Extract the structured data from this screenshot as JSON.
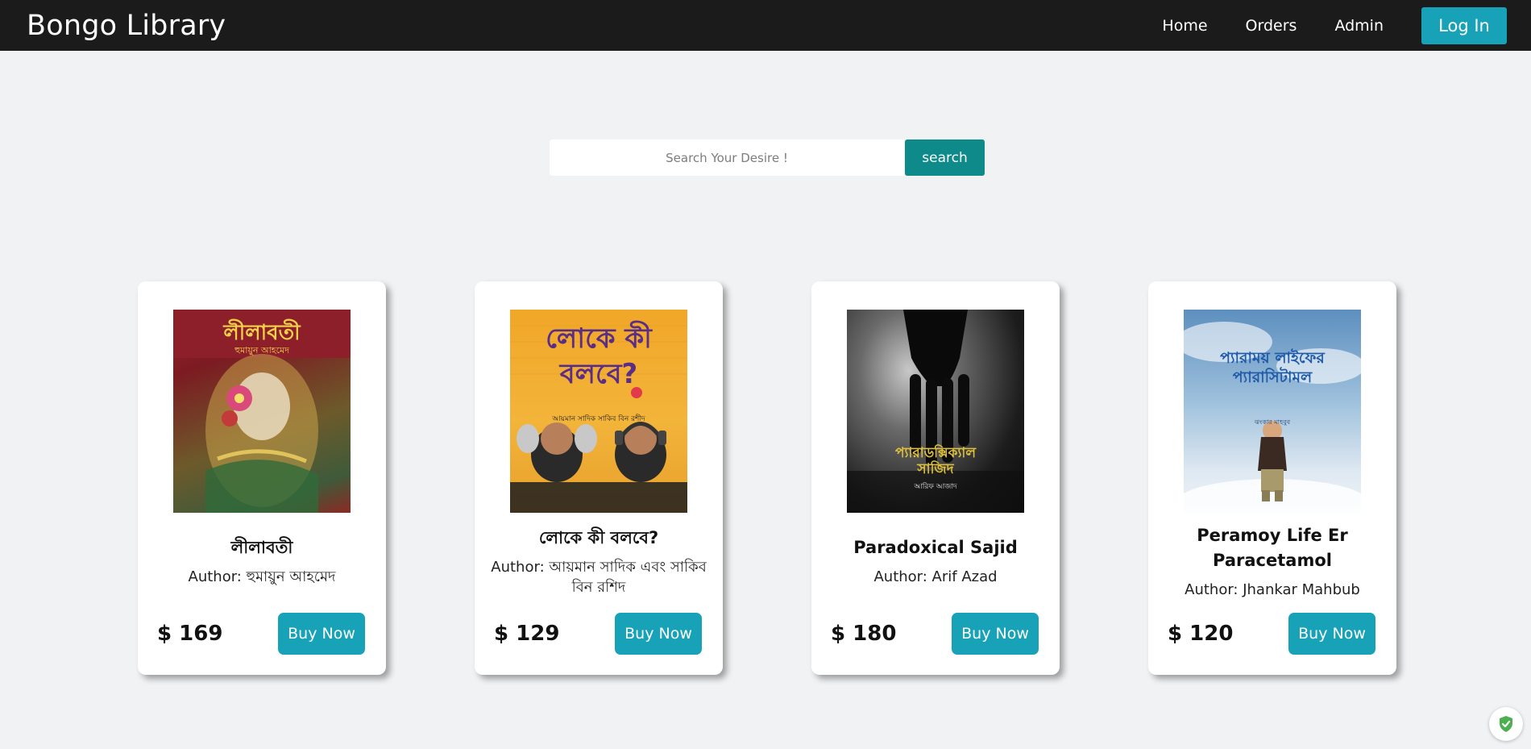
{
  "navbar": {
    "brand": "Bongo Library",
    "links": [
      "Home",
      "Orders",
      "Admin"
    ],
    "login_label": "Log In"
  },
  "search": {
    "placeholder": "Search Your Desire !",
    "value": "",
    "button_label": "search"
  },
  "books": [
    {
      "title": "লীলাবতী",
      "author": "Author: হুমায়ুন আহমেদ",
      "price": "$ 169",
      "buy_label": "Buy Now",
      "cover_title": "লীলাবতী",
      "cover_author": "হুমায়ুন আহমেদ"
    },
    {
      "title": "লোকে কী বলবে?",
      "author": "Author: আয়মান সাদিক  এবং সাকিব বিন রশিদ",
      "price": "$ 129",
      "buy_label": "Buy Now",
      "cover_title": "লোকে কী বলবে?",
      "cover_author": "আয়মান সাদিক   সাকিব বিন রশীদ"
    },
    {
      "title": "Paradoxical Sajid",
      "author": "Author: Arif Azad",
      "price": "$ 180",
      "buy_label": "Buy Now",
      "cover_title": "প্যারাডক্সিক্যাল সাজিদ",
      "cover_author": "আরিফ আজাদ"
    },
    {
      "title": "Peramoy Life Er Paracetamol",
      "author": "Author: Jhankar Mahbub",
      "price": "$ 120",
      "buy_label": "Buy Now",
      "cover_title": "প্যারাময় লাইফের প্যারাসিটামল",
      "cover_author": "ঝংকার মাহবুব"
    }
  ],
  "colors": {
    "navbar_bg": "#1b1b1b",
    "accent": "#17a2b8",
    "search_button": "#0f8a8a",
    "page_bg": "#f0f2f4"
  },
  "icons": [
    "shield-check-icon"
  ]
}
